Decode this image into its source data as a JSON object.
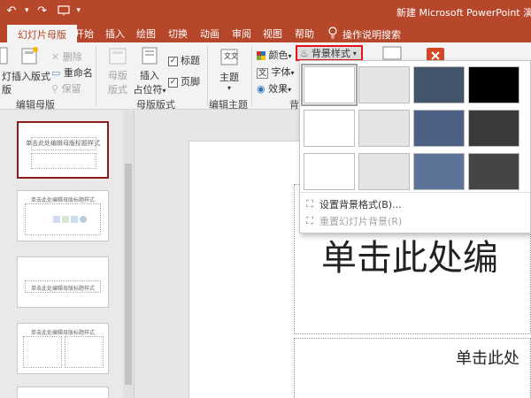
{
  "window": {
    "title": "新建 Microsoft PowerPoint 演示文"
  },
  "qat": {
    "undo_icon": "undo-icon",
    "redo_icon": "redo-icon",
    "presenter_icon": "present-from-start-icon"
  },
  "tabs": [
    {
      "label": "幻灯片母版",
      "active": true
    },
    {
      "label": "开始"
    },
    {
      "label": "插入"
    },
    {
      "label": "绘图"
    },
    {
      "label": "切换"
    },
    {
      "label": "动画"
    },
    {
      "label": "审阅"
    },
    {
      "label": "视图"
    },
    {
      "label": "帮助"
    },
    {
      "label": "操作说明搜索"
    }
  ],
  "ribbon": {
    "edit_master": {
      "label": "编辑母版",
      "insert_slide_master_short": "灯",
      "insert_slide_master_short2": "版",
      "insert_layout": "插入版式",
      "delete": "删除",
      "rename": "重命名",
      "preserve": "保留"
    },
    "master_layout": {
      "label": "母版版式",
      "master_layout_btn_1": "母版",
      "master_layout_btn_2": "版式",
      "insert_placeholder_1": "插入",
      "insert_placeholder_2": "占位符",
      "title_check": "标题",
      "footer_check": "页脚"
    },
    "edit_theme": {
      "label": "编辑主题",
      "themes": "主题"
    },
    "background": {
      "colors": "颜色",
      "fonts": "字体",
      "effects": "效果",
      "label_fragment": "背",
      "background_styles": "背景样式"
    }
  },
  "dropdown": {
    "swatches": [
      {
        "color": "#ffffff"
      },
      {
        "color": "#e4e4e4"
      },
      {
        "color": "#44546a"
      },
      {
        "color": "#000000"
      },
      {
        "color": "#ffffff"
      },
      {
        "color": "#e4e4e4"
      },
      {
        "color": "#4e6184"
      },
      {
        "color": "#3a3a3a"
      },
      {
        "color": "#ffffff"
      },
      {
        "color": "#e4e4e4"
      },
      {
        "color": "#5d7397"
      },
      {
        "color": "#454545"
      }
    ],
    "format_background": "设置背景格式(B)...",
    "reset_background": "重置幻灯片背景(R)"
  },
  "thumbnails": {
    "title_text": "单击此处编辑母版标题样式"
  },
  "slide": {
    "title_placeholder": "单击此处编",
    "subtitle_placeholder": "单击此处"
  }
}
